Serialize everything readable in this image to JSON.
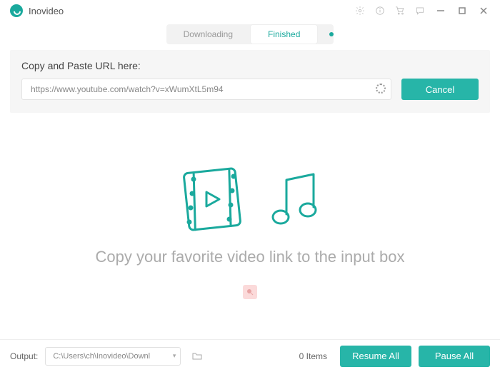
{
  "app": {
    "title": "Inovideo"
  },
  "tabs": {
    "downloading": "Downloading",
    "finished": "Finished",
    "active": "finished"
  },
  "url_panel": {
    "label": "Copy and Paste URL here:",
    "value": "https://www.youtube.com/watch?v=xWumXtL5m94",
    "cancel": "Cancel"
  },
  "main": {
    "placeholder": "Copy your favorite video link to the input box"
  },
  "footer": {
    "output_label": "Output:",
    "output_path": "C:\\Users\\ch\\Inovideo\\Downl",
    "items_count": "0 Items",
    "resume": "Resume All",
    "pause": "Pause All"
  },
  "colors": {
    "accent": "#27b5a8"
  }
}
